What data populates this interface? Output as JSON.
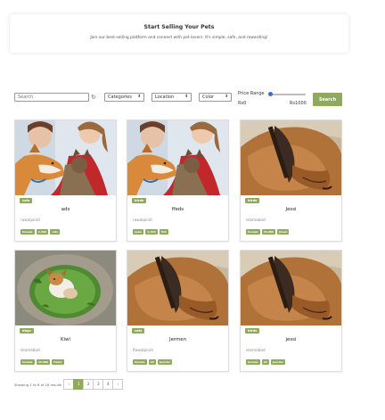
{
  "banner": {
    "title": "Start Selling Your Pets",
    "subtitle": "Join our best-selling platform and connect with pet lovers. It's simple, safe, and rewarding!"
  },
  "filters": {
    "search_placeholder": "Search",
    "category": "Categories",
    "location": "Location",
    "color": "Color",
    "price_label": "Price Range",
    "price_min": "Rs0",
    "price_max": "Rs1000",
    "price_level_percent": 0,
    "search_button": "Search"
  },
  "cards": [
    {
      "badge": "cats",
      "name": "ads",
      "location": "rawalpindi",
      "tags": [
        "female",
        "2,500",
        "cats"
      ],
      "image": "dog-cat"
    },
    {
      "badge": "birds",
      "name": "ffeds",
      "location": "rawalpindi",
      "tags": [
        "male",
        "4,326",
        "Hot"
      ],
      "image": "dog-cat"
    },
    {
      "badge": "birds",
      "name": "Jessi",
      "location": "islamabad",
      "tags": [
        "female",
        "25,000",
        "Jhaak"
      ],
      "image": "sleeping-dog"
    },
    {
      "badge": "dogs",
      "name": "Kiwi",
      "location": "islamabad",
      "tags": [
        "female",
        "25,000",
        "Hazel"
      ],
      "image": "small-dog-grass"
    },
    {
      "badge": "cats",
      "name": "Jermen",
      "location": "Rawalpindi",
      "tags": [
        "female",
        "20",
        "Jeorder"
      ],
      "image": "sleeping-dog"
    },
    {
      "badge": "birds",
      "name": "jessi",
      "location": "islamabad",
      "tags": [
        "female",
        "20",
        "Jeorder"
      ],
      "image": "sleeping-dog"
    }
  ],
  "pagination": {
    "showing": "Showing 1 to 6 of 18 results",
    "prev": "‹",
    "pages": [
      "1",
      "2",
      "3",
      "4"
    ],
    "next": "›",
    "active": "1"
  },
  "icons": {
    "refresh": "refresh-icon",
    "chevron": "chevron-updown-icon"
  },
  "colors": {
    "accent": "#8eaa5a",
    "slider": "#2f6fd6"
  }
}
